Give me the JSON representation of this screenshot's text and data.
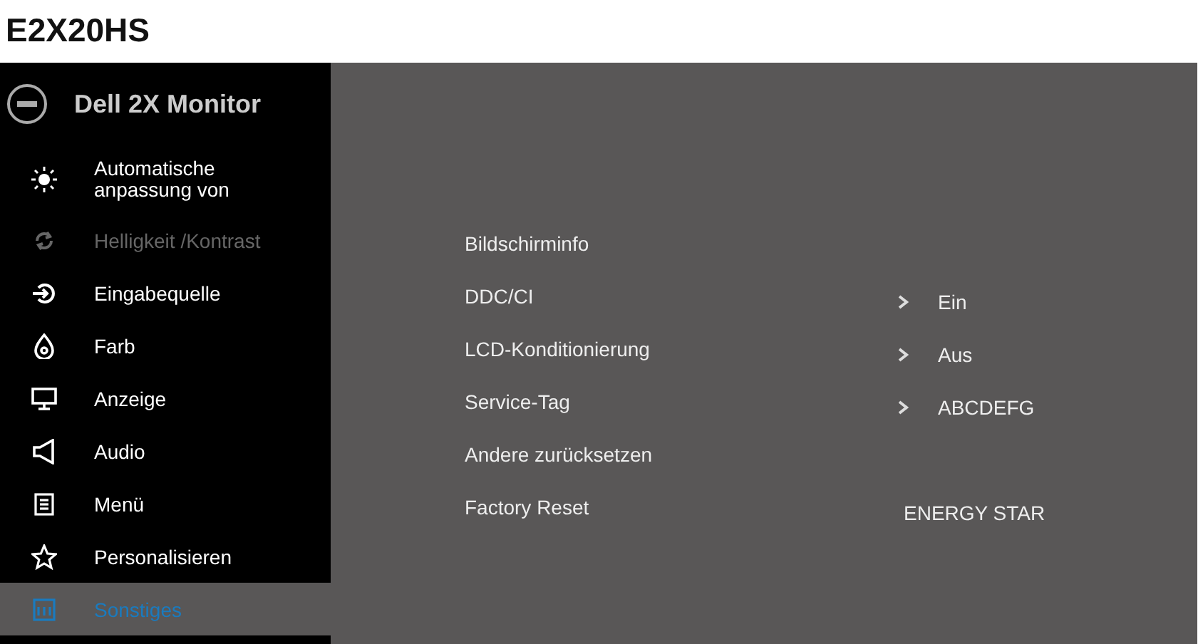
{
  "page_title": "E2X20HS",
  "menu": {
    "title": "Dell 2X Monitor",
    "items": [
      {
        "label": "Automatische anpassung von",
        "disabled": false,
        "selected": false
      },
      {
        "label": "Helligkeit /Kontrast",
        "disabled": true,
        "selected": false
      },
      {
        "label": "Eingabequelle",
        "disabled": false,
        "selected": false
      },
      {
        "label": "Farb",
        "disabled": false,
        "selected": false
      },
      {
        "label": "Anzeige",
        "disabled": false,
        "selected": false
      },
      {
        "label": "Audio",
        "disabled": false,
        "selected": false
      },
      {
        "label": "Menü",
        "disabled": false,
        "selected": false
      },
      {
        "label": "Personalisieren",
        "disabled": false,
        "selected": false
      },
      {
        "label": "Sonstiges",
        "disabled": false,
        "selected": true
      }
    ]
  },
  "settings": [
    {
      "label": "Bildschirminfo"
    },
    {
      "label": "DDC/CI",
      "value": "Ein",
      "chevron": true
    },
    {
      "label": "LCD-Konditionierung",
      "value": "Aus",
      "chevron": true
    },
    {
      "label": "Service-Tag",
      "value": "ABCDEFG",
      "chevron": true
    },
    {
      "label": "Andere zurücksetzen"
    },
    {
      "label": "Factory Reset",
      "value": "ENERGY STAR",
      "chevron": false
    }
  ]
}
